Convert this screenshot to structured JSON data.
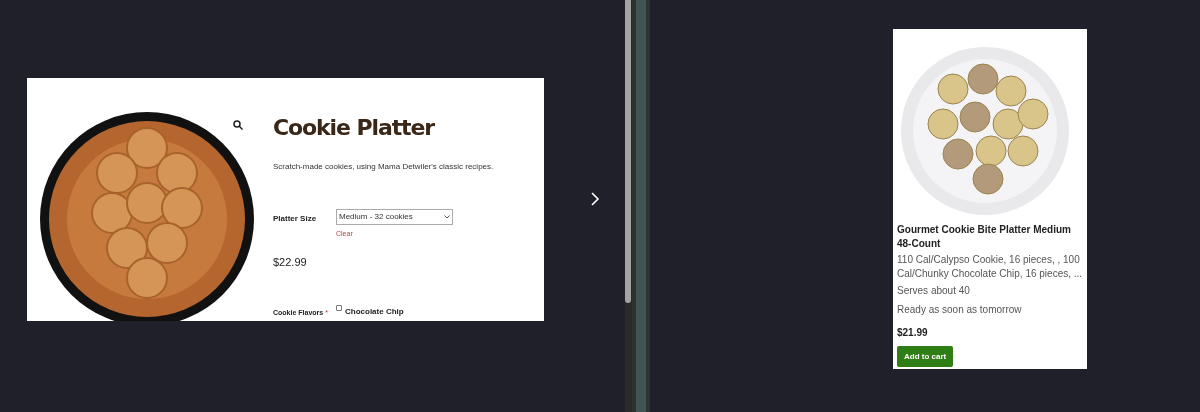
{
  "left_product": {
    "title": "Cookie Platter",
    "description": "Scratch-made cookies, using Mama Detwiler's classic recipes.",
    "options": [
      {
        "label": "Platter Size",
        "value": "Medium - 32 cookies",
        "clear": "Clear"
      }
    ],
    "price": "$22.99",
    "flavors": {
      "label": "Cookie Flavors",
      "required": true,
      "required_mark": "*",
      "choices": [
        {
          "label": "Chocolate Chip",
          "checked": false
        }
      ]
    }
  },
  "right_product": {
    "name": "Gourmet Cookie Bite Platter Medium 48-Count",
    "description": "110 Cal/Calypso Cookie, 16 pieces, , 100 Cal/Chunky Chocolate Chip, 16 pieces, ...",
    "serves": "Serves about 40",
    "availability": "Ready as soon as tomorrow",
    "price": "$21.99",
    "button": "Add to cart"
  }
}
